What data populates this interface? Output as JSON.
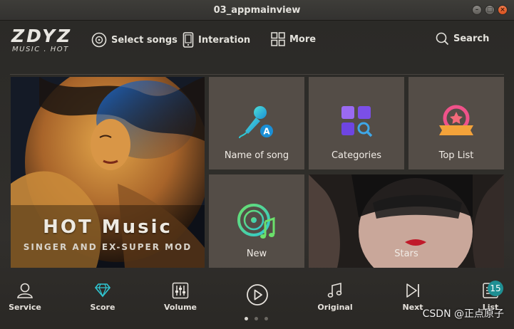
{
  "window": {
    "title": "03_appmainview"
  },
  "logo": {
    "line1": "ZDYZ",
    "line2": "MUSIC . HOT"
  },
  "nav": {
    "select_songs": "Select songs",
    "interaction": "Interation",
    "more": "More",
    "search": "Search"
  },
  "hero": {
    "title": "HOT Music",
    "subtitle": "SINGER AND EX-SUPER MOD"
  },
  "tiles": {
    "name_of_song": "Name of song",
    "categories": "Categories",
    "top_list": "Top List",
    "new": "New",
    "stars": "Stars"
  },
  "bottom": {
    "service": "Service",
    "score": "Score",
    "volume": "Volume",
    "original": "Original",
    "next": "Next",
    "list": "List",
    "list_badge": "15"
  },
  "watermark": "CSDN @正点原子",
  "colors": {
    "accent_cyan": "#2fc7d3",
    "accent_green": "#6be06b",
    "accent_purple": "#8a5cf0",
    "badge": "#1f8f93"
  }
}
